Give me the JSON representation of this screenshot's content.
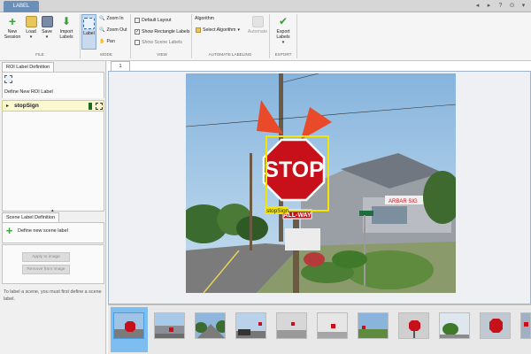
{
  "window": {
    "tab": "LABEL",
    "quick_access": [
      "◂",
      "▸",
      "?",
      "⊙",
      "▾"
    ]
  },
  "ribbon": {
    "new_session": "New\nSession",
    "load": "Load",
    "save": "Save",
    "import_labels": "Import\nLabels",
    "label": "Label",
    "zoom_in": "Zoom In",
    "zoom_out": "Zoom Out",
    "pan": "Pan",
    "default_layout": "Default Layout",
    "show_rect_labels": "Show Rectangle Labels",
    "show_scene_labels": "Show Scene Labels",
    "algorithm_label": "Algorithm",
    "select_algorithm": "Select Algorithm",
    "automate": "Automate",
    "export_labels": "Export\nLabels",
    "sections": {
      "file": "FILE",
      "mode": "MODE",
      "view": "VIEW",
      "automate": "AUTOMATE LABELING",
      "export": "EXPORT"
    }
  },
  "roi_panel": {
    "tab": "ROI Label Definition",
    "define_label": "Define New ROI Label",
    "labels": [
      {
        "name": "stopSign",
        "color": "#1e6a1e"
      }
    ]
  },
  "scene_panel": {
    "tab": "Scene Label Definition",
    "define_label": "Define new scene label",
    "apply": "Apply to image",
    "remove": "Remove from image",
    "hint": "To label a scene, you must first define a scene label."
  },
  "viewer": {
    "tab": "1",
    "roi_label": "stopSign",
    "sign_text": "STOP",
    "sign_all_way": "ALL-WAY",
    "colors": {
      "roi": "#f5e400",
      "sign": "#c8101a"
    }
  },
  "thumbnails_count": 11
}
